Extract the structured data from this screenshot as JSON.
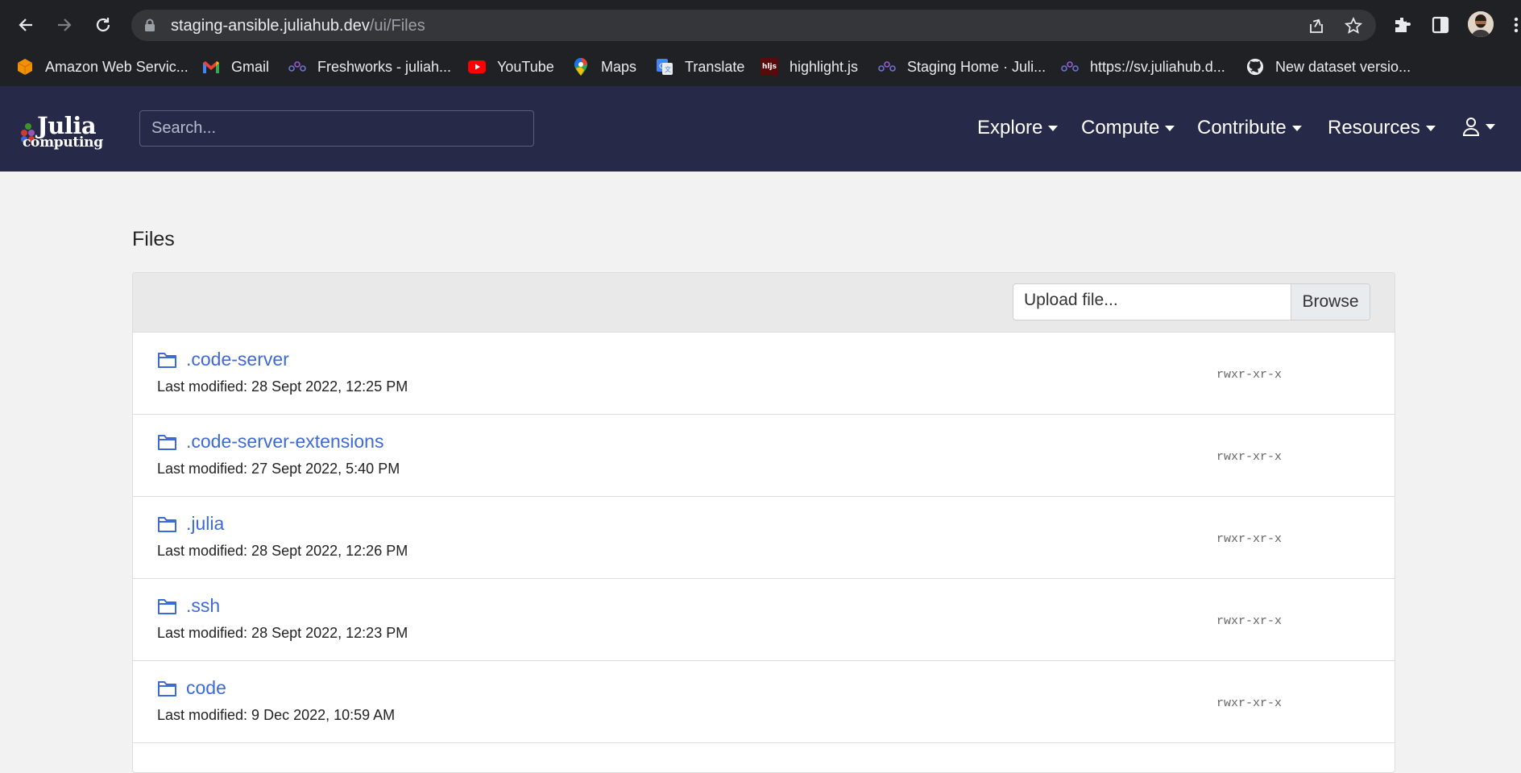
{
  "browser": {
    "url_host": "staging-ansible.juliahub.dev",
    "url_path": "/ui/Files",
    "bookmarks": [
      {
        "label": "Amazon Web Servic...",
        "icon": "aws-icon"
      },
      {
        "label": "Gmail",
        "icon": "gmail-icon"
      },
      {
        "label": "Freshworks - juliah...",
        "icon": "freshworks-icon"
      },
      {
        "label": "YouTube",
        "icon": "youtube-icon"
      },
      {
        "label": "Maps",
        "icon": "maps-icon"
      },
      {
        "label": "Translate",
        "icon": "translate-icon"
      },
      {
        "label": "highlight.js",
        "icon": "hljs-icon",
        "icon_text": "hljs"
      },
      {
        "label": "Staging Home · Juli...",
        "icon": "juliahub-icon"
      },
      {
        "label": "https://sv.juliahub.d...",
        "icon": "juliahub-icon"
      },
      {
        "label": "New dataset versio...",
        "icon": "github-icon"
      }
    ]
  },
  "navbar": {
    "logo_top": "Julia",
    "logo_bottom": "computing",
    "search_placeholder": "Search...",
    "menu": [
      {
        "label": "Explore"
      },
      {
        "label": "Compute"
      },
      {
        "label": "Contribute"
      },
      {
        "label": "Resources"
      }
    ]
  },
  "page": {
    "title": "Files",
    "upload_placeholder": "Upload file...",
    "browse_label": "Browse",
    "files": [
      {
        "name": ".code-server",
        "modified": "Last modified: 28 Sept 2022, 12:25 PM",
        "permissions": "rwxr-xr-x"
      },
      {
        "name": ".code-server-extensions",
        "modified": "Last modified: 27 Sept 2022, 5:40 PM",
        "permissions": "rwxr-xr-x"
      },
      {
        "name": ".julia",
        "modified": "Last modified: 28 Sept 2022, 12:26 PM",
        "permissions": "rwxr-xr-x"
      },
      {
        "name": ".ssh",
        "modified": "Last modified: 28 Sept 2022, 12:23 PM",
        "permissions": "rwxr-xr-x"
      },
      {
        "name": "code",
        "modified": "Last modified: 9 Dec 2022, 10:59 AM",
        "permissions": "rwxr-xr-x"
      }
    ]
  },
  "colors": {
    "navbar_bg": "#262a48",
    "link": "#3d6ad6",
    "page_bg": "#f2f2f2"
  }
}
